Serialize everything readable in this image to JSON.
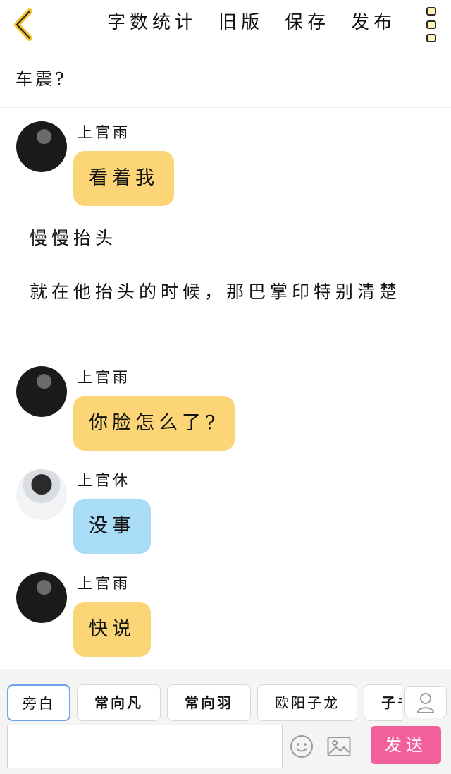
{
  "header": {
    "actions": [
      "字数统计",
      "旧版",
      "保存",
      "发布"
    ]
  },
  "chapter": {
    "title": "车震?"
  },
  "messages": [
    {
      "sender": "上官雨",
      "text": "看着我",
      "color": "#fcd676"
    },
    {
      "sender": "上官雨",
      "text": "你脸怎么了?",
      "color": "#fcd676"
    },
    {
      "sender": "上官休",
      "text": "没事",
      "color": "#a8dcf7"
    },
    {
      "sender": "上官雨",
      "text": "快说",
      "color": "#fcd676"
    }
  ],
  "narration": [
    "慢慢抬头",
    "就在他抬头的时候，那巴掌印特别清楚"
  ],
  "composer": {
    "role_chips": [
      "旁白",
      "常向凡",
      "常向羽",
      "欧阳子龙",
      "子书"
    ],
    "input_value": "",
    "send_label": "发送",
    "send_color": "#f2609c",
    "icons": [
      "back-chevron-icon",
      "menu-icon",
      "person-icon",
      "emoji-icon",
      "image-icon"
    ]
  },
  "colors": {
    "bubble_yellow": "#fcd676",
    "bubble_blue": "#a8dcf7",
    "chip_active_border": "#6ea5e6",
    "accent_yellow": "#f2c230"
  }
}
